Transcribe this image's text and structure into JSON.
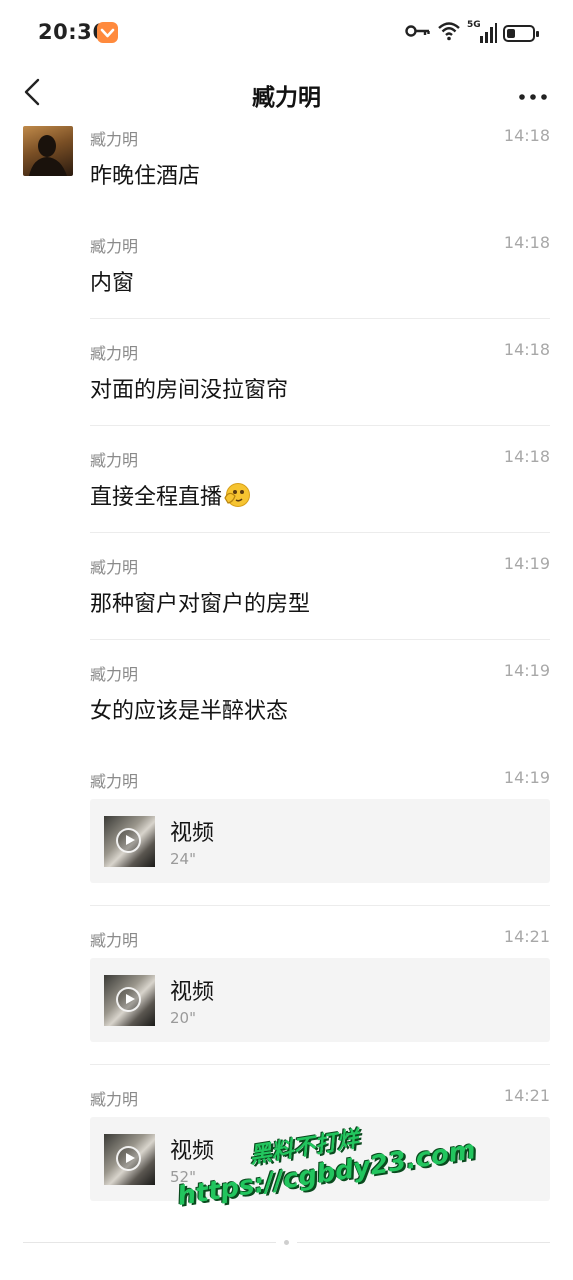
{
  "status_bar": {
    "time": "20:36",
    "network": "5G",
    "battery_level": 0.35,
    "icons": [
      "app-notification-icon",
      "key-icon",
      "wifi-icon",
      "signal-icon",
      "battery-icon"
    ]
  },
  "header": {
    "title": "臧力明",
    "back_icon": "chevron-left-icon",
    "more_icon": "more-dots-icon"
  },
  "messages": [
    {
      "sender": "臧力明",
      "time": "14:18",
      "type": "text",
      "text": "昨晚住酒店"
    },
    {
      "sender": "臧力明",
      "time": "14:18",
      "type": "text",
      "text": "内窗"
    },
    {
      "sender": "臧力明",
      "time": "14:18",
      "type": "text",
      "text": "对面的房间没拉窗帘"
    },
    {
      "sender": "臧力明",
      "time": "14:18",
      "type": "text",
      "text": "直接全程直播",
      "emoji": "peeking-emoji-icon"
    },
    {
      "sender": "臧力明",
      "time": "14:19",
      "type": "text",
      "text": "那种窗户对窗户的房型"
    },
    {
      "sender": "臧力明",
      "time": "14:19",
      "type": "text",
      "text": "女的应该是半醉状态"
    },
    {
      "sender": "臧力明",
      "time": "14:19",
      "type": "video",
      "title": "视频",
      "duration": "24\""
    },
    {
      "sender": "臧力明",
      "time": "14:21",
      "type": "video",
      "title": "视频",
      "duration": "20\""
    },
    {
      "sender": "臧力明",
      "time": "14:21",
      "type": "video",
      "title": "视频",
      "duration": "52\""
    }
  ],
  "watermark": {
    "line1": "黑料不打烊",
    "line2": "https://cgbdy23.com",
    "color": "#22c55e"
  }
}
